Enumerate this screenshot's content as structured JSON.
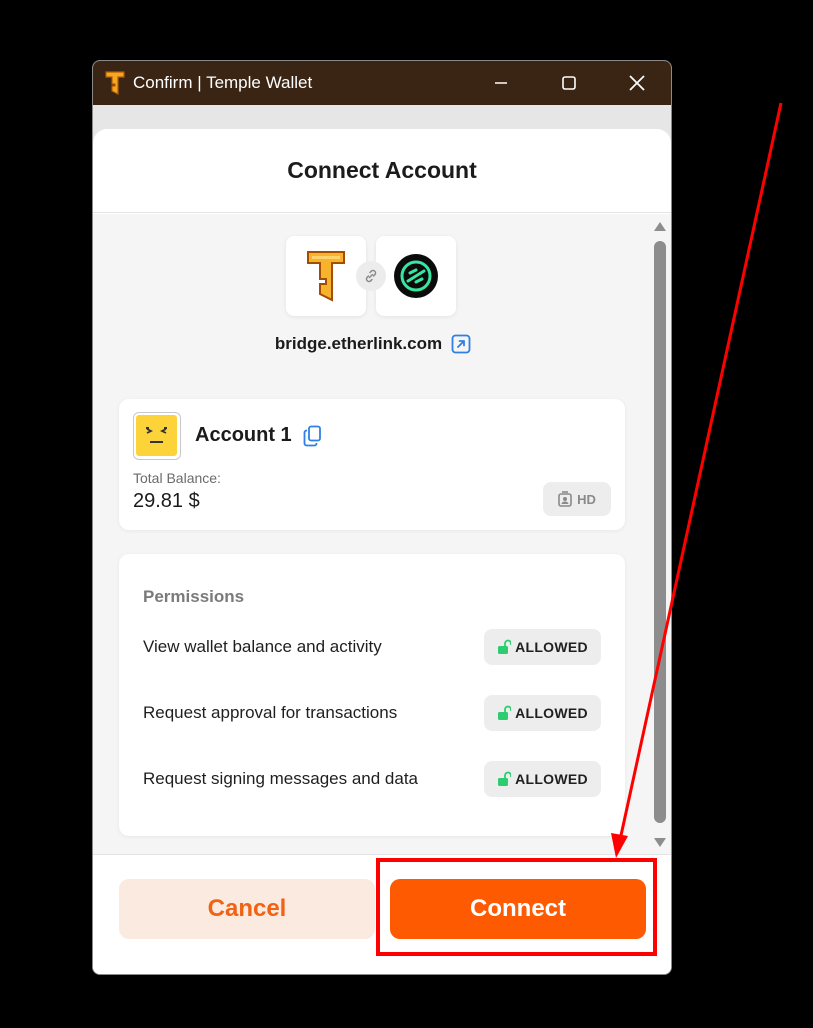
{
  "window": {
    "title": "Confirm | Temple Wallet",
    "controls": {
      "minimize": "minimize-icon",
      "maximize": "maximize-icon",
      "close": "close-icon"
    }
  },
  "header": {
    "title": "Connect Account"
  },
  "dapp": {
    "url": "bridge.etherlink.com",
    "wallet_logo": "temple-key-logo",
    "dapp_logo": "etherlink-logo",
    "link_icon": "link-icon",
    "external_icon": "external-link-icon"
  },
  "account": {
    "name": "Account 1",
    "balance_label": "Total Balance:",
    "balance_value": "29.81 $",
    "badge": "HD",
    "avatar": "account-avatar-icon",
    "copy_icon": "copy-icon"
  },
  "permissions": {
    "title": "Permissions",
    "items": [
      {
        "label": "View wallet balance and activity",
        "status": "ALLOWED"
      },
      {
        "label": "Request approval for transactions",
        "status": "ALLOWED"
      },
      {
        "label": "Request signing messages and data",
        "status": "ALLOWED"
      }
    ]
  },
  "footer": {
    "cancel_label": "Cancel",
    "connect_label": "Connect"
  },
  "colors": {
    "titlebar": "#3a2413",
    "accent": "#fe5a02",
    "cancel_bg": "#fbeae0",
    "cancel_text": "#f26214",
    "allowed_icon": "#2ecc71",
    "annotation": "#ff0000"
  }
}
